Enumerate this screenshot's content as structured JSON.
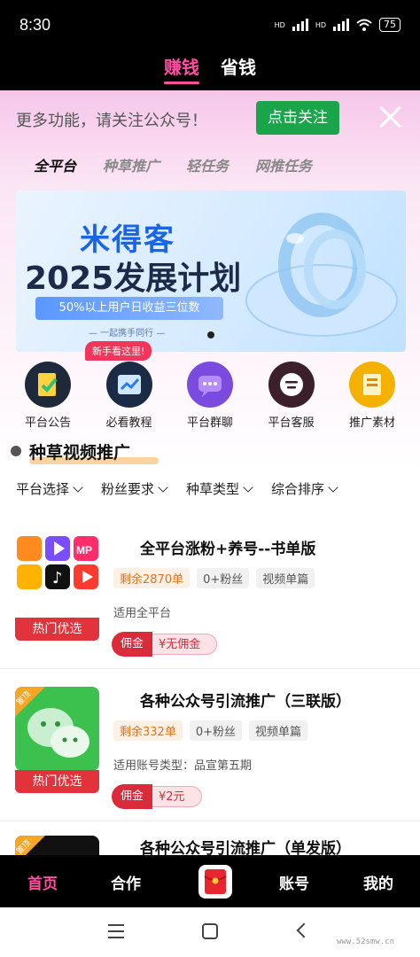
{
  "status_bar": {
    "time": "8:30",
    "network1": "HD",
    "network2": "HD",
    "battery": "75"
  },
  "top_tabs": [
    {
      "label": "赚钱",
      "active": true
    },
    {
      "label": "省钱",
      "active": false
    }
  ],
  "notice": {
    "text": "更多功能，请关注公众号！",
    "follow_label": "点击关注"
  },
  "category_tabs": [
    {
      "label": "全平台",
      "active": true
    },
    {
      "label": "种草推广",
      "active": false
    },
    {
      "label": "轻任务",
      "active": false
    },
    {
      "label": "网推任务",
      "active": false
    }
  ],
  "banner": {
    "brand": "米得客",
    "headline": "2025发展计划",
    "pill": "50%以上用户日收益三位数",
    "tagline": "— 一起携手同行 —"
  },
  "new_badge": "新手看这里!",
  "quick_links": [
    {
      "label": "平台公告",
      "icon": "announcement-icon",
      "color": "#1e2a3a"
    },
    {
      "label": "必看教程",
      "icon": "tutorial-chart-icon",
      "color": "#1c2b45"
    },
    {
      "label": "平台群聊",
      "icon": "group-chat-icon",
      "color": "#7b4be0"
    },
    {
      "label": "平台客服",
      "icon": "customer-service-icon",
      "color": "#3b1f2b"
    },
    {
      "label": "推广素材",
      "icon": "promo-material-icon",
      "color": "#f5b100"
    }
  ],
  "section": {
    "title": "种草视频推广"
  },
  "filters": [
    {
      "label": "平台选择"
    },
    {
      "label": "粉丝要求"
    },
    {
      "label": "种草类型"
    },
    {
      "label": "综合排序"
    }
  ],
  "tasks": [
    {
      "title": "全平台涨粉+养号--书单版",
      "tags": [
        {
          "label": "剩余2870单",
          "style": "orange"
        },
        {
          "label": "0+粉丝",
          "style": "gray"
        },
        {
          "label": "视频单篇",
          "style": "gray"
        }
      ],
      "desc": "适用全平台",
      "hot_label": "热门优选",
      "commission_label": "佣金",
      "commission_value": "¥无佣金",
      "thumb": "multi-platform-apps-icon"
    },
    {
      "title": "各种公众号引流推广（三联版）",
      "tags": [
        {
          "label": "剩余332单",
          "style": "orange"
        },
        {
          "label": "0+粉丝",
          "style": "gray"
        },
        {
          "label": "视频单篇",
          "style": "gray"
        }
      ],
      "desc": "适用账号类型：品宣第五期",
      "hot_label": "热门优选",
      "commission_label": "佣金",
      "commission_value": "¥2元",
      "thumb": "wechat-icon",
      "corner": "置顶"
    },
    {
      "title": "各种公众号引流推广（单发版）",
      "corner": "置顶"
    }
  ],
  "bottom_nav": [
    {
      "label": "首页",
      "active": true
    },
    {
      "label": "合作",
      "active": false
    },
    {
      "label": "账号",
      "active": false
    },
    {
      "label": "我的",
      "active": false
    }
  ],
  "watermark": "www.52smw.cn"
}
